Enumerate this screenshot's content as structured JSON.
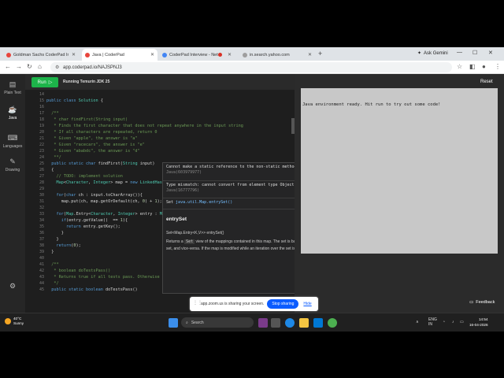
{
  "browser": {
    "tabs": [
      {
        "label": "Goldman Sachs CoderPad Inte",
        "fav_color": "#e8453c"
      },
      {
        "label": "Java | CoderPad",
        "fav_color": "#e8453c",
        "active": true
      },
      {
        "label": "CoderPad Interview - Netw",
        "fav_color": "#4285f4"
      },
      {
        "label": "in.search.yahoo.com",
        "fav_color": "#9e9e9e"
      }
    ],
    "new_tab": "+",
    "ask_gemini": "Ask Gemini",
    "url": "app.coderpad.io/NAJSPNJ3",
    "icons": [
      "back-arrow",
      "forward-arrow",
      "reload",
      "home",
      "star",
      "extensions",
      "profile",
      "menu"
    ]
  },
  "nav": {
    "items": [
      {
        "label": "Plain Text",
        "icon": "document-icon"
      },
      {
        "label": "Java",
        "icon": "java-icon"
      },
      {
        "label": "Languages",
        "icon": "languages-icon"
      },
      {
        "label": "Drawing",
        "icon": "drawing-icon"
      }
    ],
    "settings_icon": "gear-icon"
  },
  "toolbar": {
    "run_label": "Run",
    "runtime_label": "Running Temurin JDK 25"
  },
  "editor": {
    "line_numbers": [
      "14",
      "15",
      "16",
      "17",
      "18",
      "19",
      "20",
      "21",
      "22",
      "23",
      "24",
      "25",
      "26",
      "27",
      "28",
      "29",
      "30",
      "31",
      "32",
      "33",
      "34",
      "35",
      "36",
      "37",
      "38",
      "39",
      "40",
      "41",
      "42",
      "43",
      "44",
      "45"
    ],
    "lines": [
      "",
      "public class Solution {",
      "",
      "  /**",
      "   * char findFirst(String input)",
      "   * Finds the first character that does not repeat anywhere in the input string",
      "   * If all characters are repeated, return 0",
      "   * Given \"apple\", the answer is \"a\"",
      "   * Given \"racecars\", the answer is \"e\"",
      "   * Given \"ababdc\", the answer is \"d\"",
      "   **/",
      "  public static char findFirst(String input)",
      "  {",
      "    // TODO: implement solution",
      "    Map<Character, Integer> map = new LinkedHashMap<>();",
      "",
      "    for(char ch : input.toCharArray()){",
      "      map.put(ch, map.getOrDefault(ch, 0) + 1);",
      "",
      "    for(Map.Entry<Character, Integer> entry : Map.entrySet()){",
      "      if(entry.getValue()  == 1){",
      "        return entry.getKey();",
      "      }",
      "    }",
      "    return(0);",
      "  }",
      "",
      "  /**",
      "   * boolean doTestsPass()",
      "   * Returns true if all tests pass. Otherwise returns false.",
      "   */",
      "  public static boolean doTestsPass()"
    ]
  },
  "tooltip": {
    "error1_text": "Cannot make a static reference to the non-static method entrySet() from the type Map",
    "error1_code": "Java(603979977)",
    "error2_text": "Type mismatch: cannot convert from element type Object to Map.Entry<Character,Integer>",
    "error2_code": "Java(16777796)",
    "ref": "java.util.Map.entrySet()",
    "heading": "entrySet",
    "signature": "Set<Map.Entry<K,V>> entrySet()",
    "desc_pre": "Returns a",
    "desc_code": "Set",
    "desc_post": "view of the mappings contained in this map. The set is backed by the map, so changes to the map are reflected in the set, and vice-versa. If the map is modified while an iteration over the set is in progress (except through"
  },
  "output": {
    "reset_label": "Reset",
    "console_text": "Java environment ready. Hit run to try out some code!",
    "feedback_label": "Feedback"
  },
  "zoom": {
    "share_text": "app.zoom.us is sharing your screen.",
    "stop_label": "Stop sharing",
    "hide_label": "Hide"
  },
  "taskbar": {
    "temp": "40°C",
    "condition": "Sunny",
    "search_placeholder": "Search",
    "lang_line1": "ENG",
    "lang_line2": "IN",
    "time": "14:54",
    "date": "16-04-2026"
  }
}
